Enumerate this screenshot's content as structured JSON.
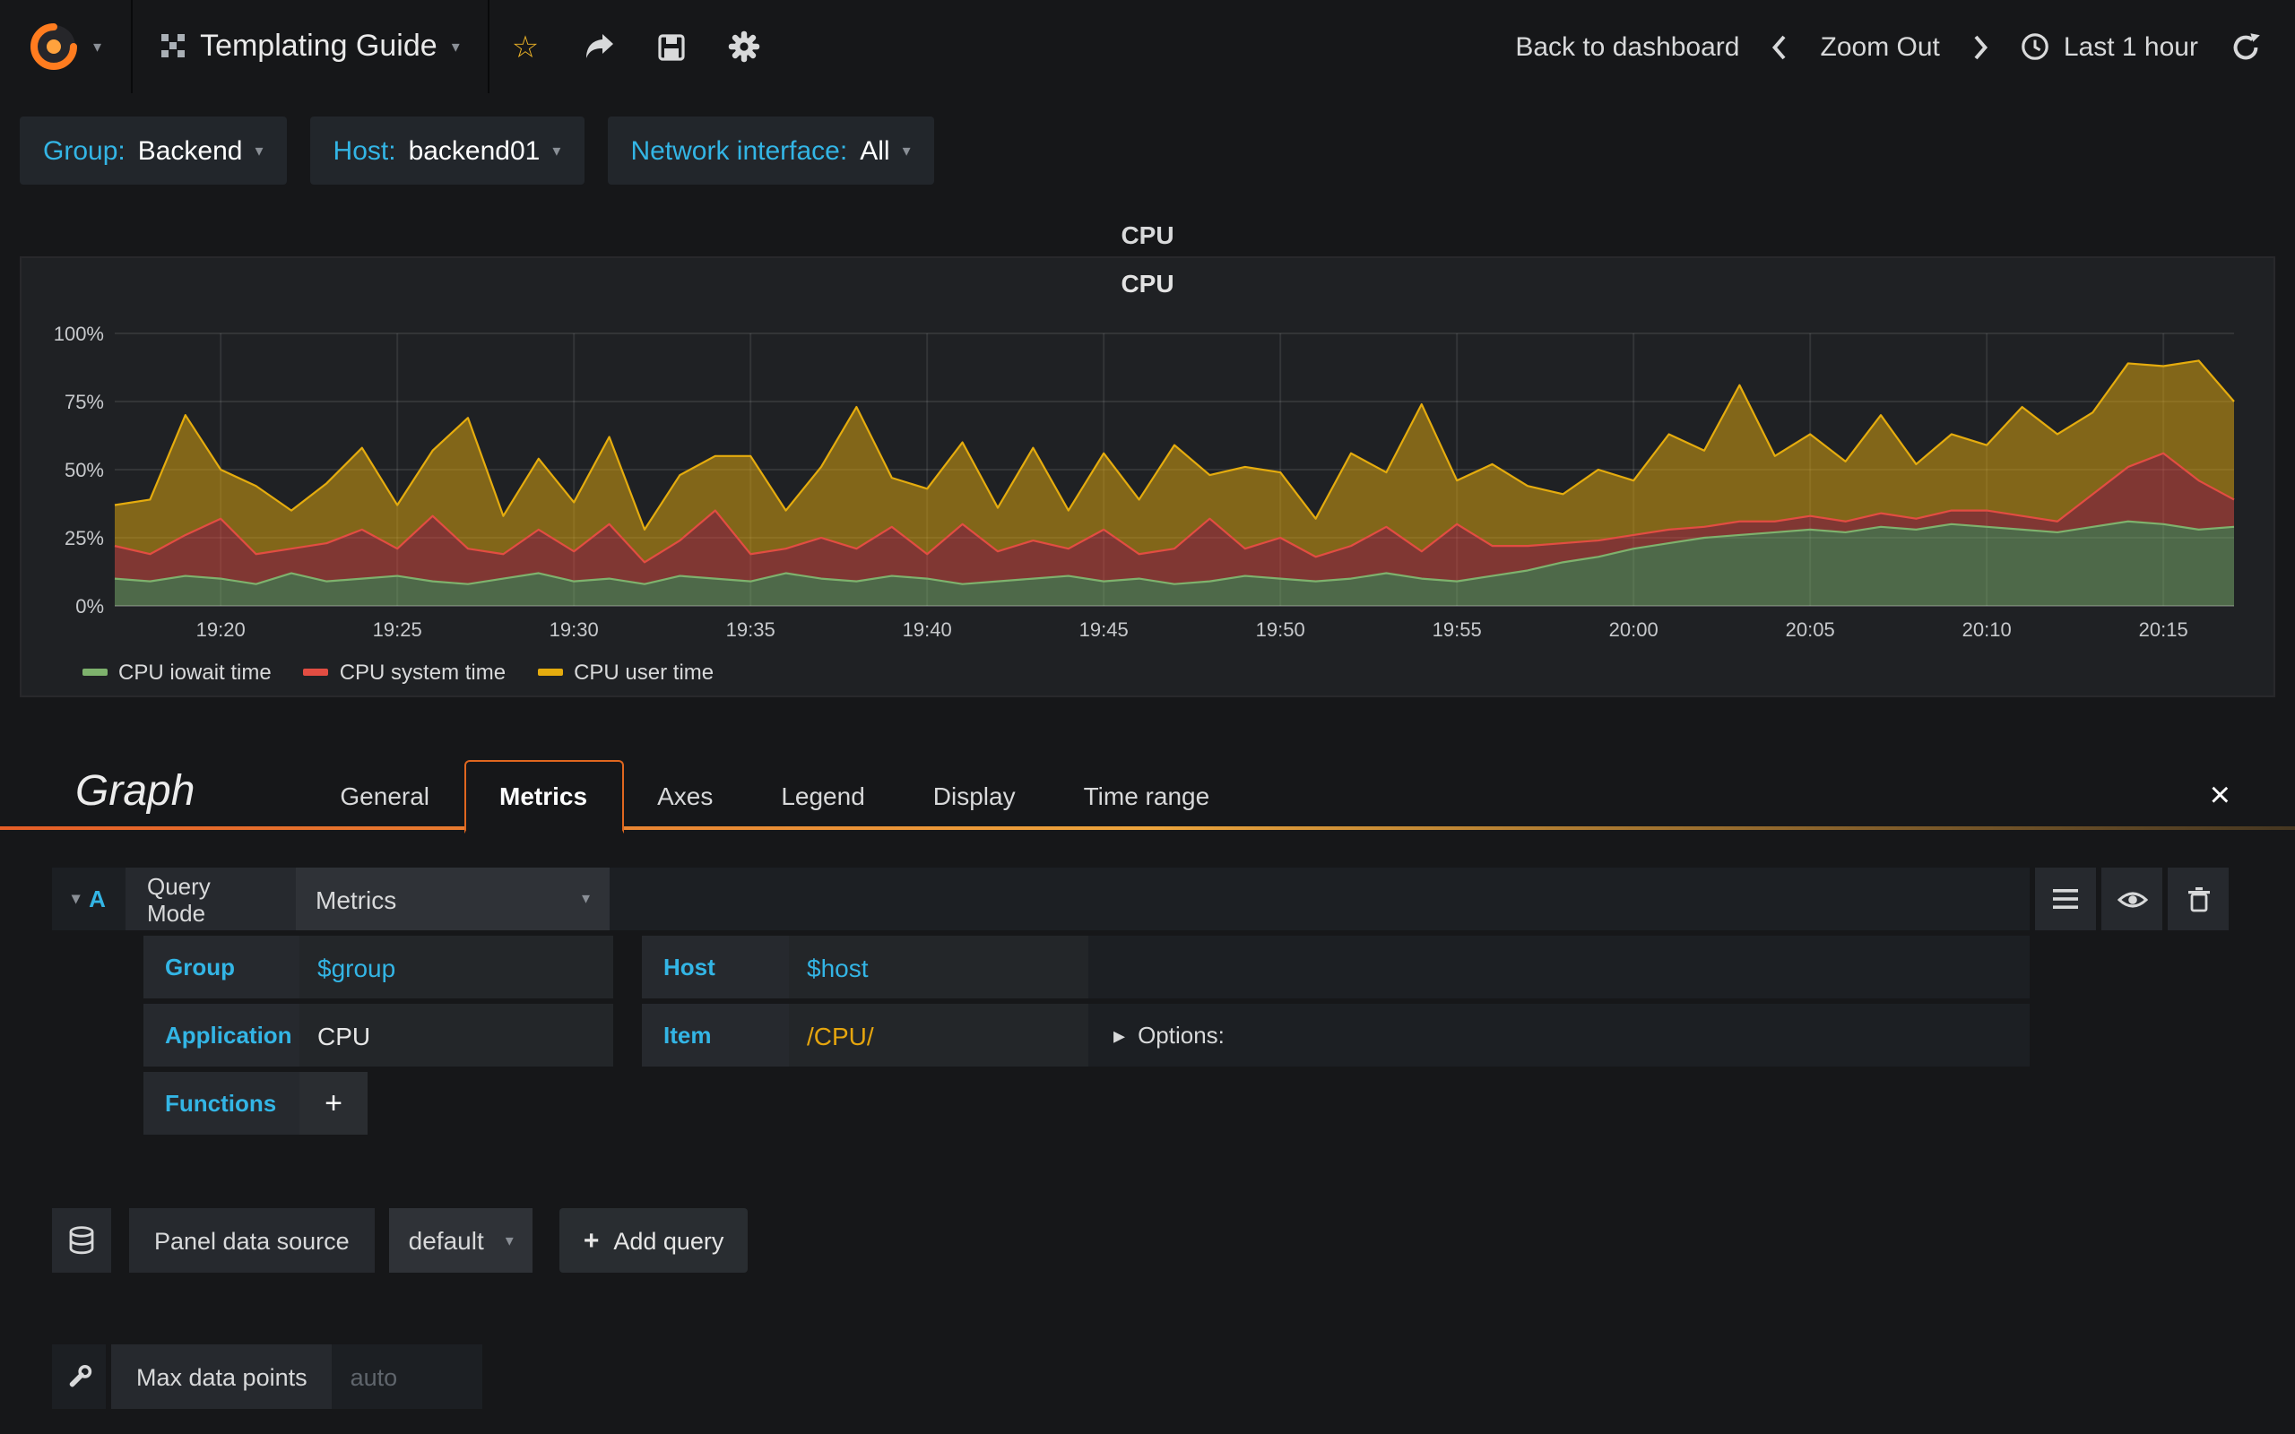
{
  "navbar": {
    "title": "Templating Guide",
    "back_to_dashboard": "Back to dashboard",
    "zoom_out": "Zoom Out",
    "time_range": "Last 1 hour"
  },
  "variables": [
    {
      "label": "Group:",
      "value": "Backend"
    },
    {
      "label": "Host:",
      "value": "backend01"
    },
    {
      "label": "Network interface:",
      "value": "All"
    }
  ],
  "panel": {
    "title": "CPU",
    "inner_title": "CPU"
  },
  "chart_data": {
    "type": "area",
    "stacked": true,
    "title": "CPU",
    "ylim": [
      0,
      100
    ],
    "y_ticks": [
      "0%",
      "25%",
      "50%",
      "75%",
      "100%"
    ],
    "x_ticks": [
      "19:20",
      "19:25",
      "19:30",
      "19:35",
      "19:40",
      "19:45",
      "19:50",
      "19:55",
      "20:00",
      "20:05",
      "20:10",
      "20:15"
    ],
    "x_tick_indices": [
      3,
      8,
      13,
      18,
      23,
      28,
      33,
      38,
      43,
      48,
      53,
      58
    ],
    "grid": true,
    "legend_position": "bottom-left",
    "series": [
      {
        "name": "CPU iowait time",
        "color": "#7eb26d",
        "values": [
          10,
          9,
          11,
          10,
          8,
          12,
          9,
          10,
          11,
          9,
          8,
          10,
          12,
          9,
          10,
          8,
          11,
          10,
          9,
          12,
          10,
          9,
          11,
          10,
          8,
          9,
          10,
          11,
          9,
          10,
          8,
          9,
          11,
          10,
          9,
          10,
          12,
          10,
          9,
          11,
          13,
          16,
          18,
          21,
          23,
          25,
          26,
          27,
          28,
          27,
          29,
          28,
          30,
          29,
          28,
          27,
          29,
          31,
          30,
          28,
          29
        ]
      },
      {
        "name": "CPU system time",
        "color": "#e24d42",
        "values": [
          12,
          10,
          15,
          22,
          11,
          9,
          14,
          18,
          10,
          24,
          13,
          9,
          16,
          11,
          20,
          8,
          13,
          25,
          10,
          9,
          15,
          12,
          18,
          9,
          22,
          11,
          14,
          10,
          19,
          9,
          13,
          23,
          10,
          15,
          9,
          12,
          17,
          10,
          21,
          11,
          9,
          7,
          6,
          5,
          5,
          4,
          5,
          4,
          5,
          4,
          5,
          4,
          5,
          6,
          5,
          4,
          12,
          20,
          26,
          18,
          10
        ]
      },
      {
        "name": "CPU user time",
        "color": "#e5ac0e",
        "values": [
          15,
          20,
          44,
          18,
          25,
          14,
          22,
          30,
          16,
          24,
          48,
          14,
          26,
          18,
          32,
          12,
          24,
          20,
          36,
          14,
          26,
          52,
          18,
          24,
          30,
          16,
          34,
          14,
          28,
          20,
          38,
          16,
          30,
          24,
          14,
          34,
          20,
          54,
          16,
          30,
          22,
          18,
          26,
          20,
          35,
          28,
          50,
          24,
          30,
          22,
          36,
          20,
          28,
          24,
          40,
          32,
          30,
          38,
          32,
          44,
          36
        ]
      }
    ]
  },
  "editor": {
    "panel_type": "Graph",
    "tabs": [
      "General",
      "Metrics",
      "Axes",
      "Legend",
      "Display",
      "Time range"
    ],
    "active_tab": "Metrics",
    "query": {
      "ref": "A",
      "query_mode_label": "Query Mode",
      "query_mode_value": "Metrics",
      "group_label": "Group",
      "group_value": "$group",
      "host_label": "Host",
      "host_value": "$host",
      "application_label": "Application",
      "application_value": "CPU",
      "item_label": "Item",
      "item_value": "/CPU/",
      "options_label": "Options:",
      "functions_label": "Functions",
      "add_function_label": "+"
    },
    "datasource": {
      "label": "Panel data source",
      "value": "default",
      "add_query_label": "Add query"
    },
    "max_data_points": {
      "label": "Max data points",
      "placeholder": "auto"
    }
  },
  "colors": {
    "accent": "#33b5e5",
    "orange": "#eb7b18",
    "background": "#161719"
  }
}
